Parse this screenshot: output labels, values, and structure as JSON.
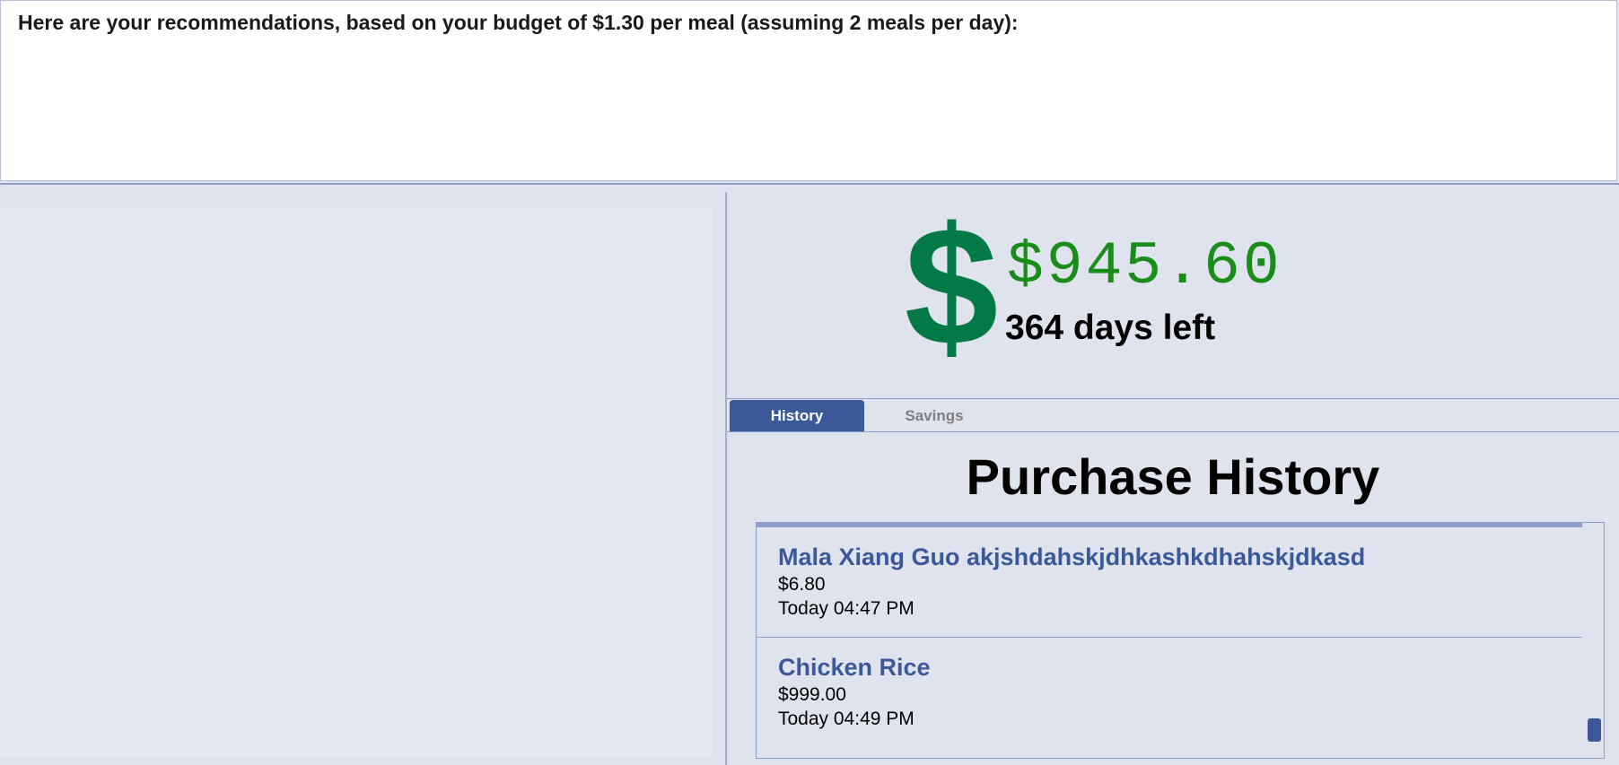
{
  "recommendations": {
    "text": "Here are your recommendations, based on your budget of $1.30 per meal (assuming 2 meals per day):"
  },
  "summary": {
    "balance": "$945.60",
    "days_left": "364 days left",
    "icon": "dollar-icon",
    "icon_glyph": "$",
    "icon_color": "#037a46",
    "balance_color": "#1a8c1a"
  },
  "tabs": [
    {
      "label": "History",
      "active": true
    },
    {
      "label": "Savings",
      "active": false
    }
  ],
  "history": {
    "title": "Purchase History",
    "items": [
      {
        "name": "Mala Xiang Guo akjshdahskjdhkashkdhahskjdkasd",
        "price": "$6.80",
        "time": "Today 04:47 PM"
      },
      {
        "name": "Chicken Rice",
        "price": "$999.00",
        "time": "Today 04:49 PM"
      }
    ]
  },
  "colors": {
    "accent": "#3b5998",
    "background": "#dfe3ee",
    "border": "#8d9fc9"
  }
}
